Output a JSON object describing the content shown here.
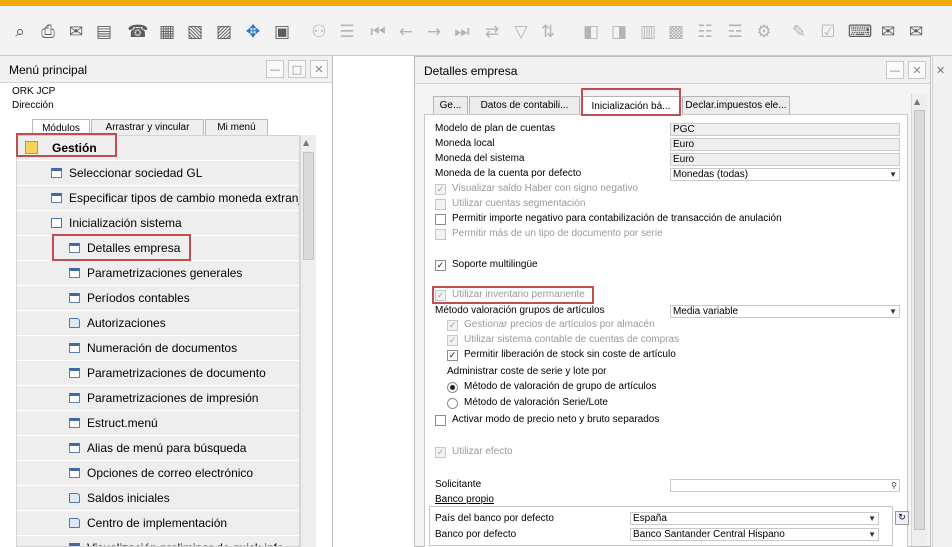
{
  "toolbar": {
    "icons": [
      "print-preview-icon",
      "print-icon",
      "email-icon",
      "sms-icon",
      "fax-icon",
      "export-excel-icon",
      "export-word-icon",
      "export-pdf-icon",
      "move-icon",
      "lock-icon",
      "binoculars-icon",
      "document-icon",
      "first-record-icon",
      "previous-record-icon",
      "next-record-icon",
      "last-record-icon",
      "refresh-icon",
      "filter-icon",
      "sort-icon",
      "base-document-icon",
      "target-document-icon",
      "layout-icon",
      "gross-profit-icon",
      "journal-icon",
      "transaction-journal-icon",
      "settings-icon",
      "pen-icon",
      "check-icon",
      "calc-icon",
      "messages-icon",
      "alerts-icon"
    ]
  },
  "menu": {
    "title": "Menú principal",
    "company": "ORK JCP",
    "role": "Dirección",
    "tabs": [
      "Módulos",
      "Arrastrar y vincular",
      "Mi menú"
    ],
    "module": "Gestión",
    "items": [
      {
        "label": "Seleccionar sociedad GL",
        "icon": "form",
        "level": 1
      },
      {
        "label": "Especificar tipos de cambio moneda extranjera",
        "icon": "form",
        "level": 1
      },
      {
        "label": "Inicialización sistema",
        "icon": "folder-open",
        "level": 1
      },
      {
        "label": "Detalles empresa",
        "icon": "form",
        "level": 2
      },
      {
        "label": "Parametrizaciones generales",
        "icon": "form",
        "level": 2
      },
      {
        "label": "Períodos contables",
        "icon": "form",
        "level": 2
      },
      {
        "label": "Autorizaciones",
        "icon": "folder",
        "level": 2
      },
      {
        "label": "Numeración de documentos",
        "icon": "form",
        "level": 2
      },
      {
        "label": "Parametrizaciones de documento",
        "icon": "form",
        "level": 2
      },
      {
        "label": "Parametrizaciones de impresión",
        "icon": "form",
        "level": 2
      },
      {
        "label": "Estruct.menú",
        "icon": "form",
        "level": 2
      },
      {
        "label": "Alias de menú para búsqueda",
        "icon": "form",
        "level": 2
      },
      {
        "label": "Opciones de correo electrónico",
        "icon": "form",
        "level": 2
      },
      {
        "label": "Saldos iniciales",
        "icon": "folder",
        "level": 2
      },
      {
        "label": "Centro de implementación",
        "icon": "folder",
        "level": 2
      },
      {
        "label": "Visualización preliminar de quick info",
        "icon": "form",
        "level": 2
      }
    ]
  },
  "details": {
    "title": "Detalles empresa",
    "tabs": [
      "Ge...",
      "Datos de contabili...",
      "Inicialización bá...",
      "Declar.impuestos ele..."
    ],
    "fields": [
      {
        "label": "Modelo de plan de cuentas",
        "value": "PGC"
      },
      {
        "label": "Moneda local",
        "value": "Euro"
      },
      {
        "label": "Moneda del sistema",
        "value": "Euro"
      },
      {
        "label": "Moneda de la cuenta por defecto",
        "value": "Monedas (todas)"
      }
    ],
    "checks1": [
      {
        "label": "Visualizar saldo Haber con signo negativo",
        "checked": true,
        "disabled": true
      },
      {
        "label": "Utilizar cuentas segmentación",
        "checked": false,
        "disabled": true
      },
      {
        "label": "Permitir importe negativo para contabilización de transacción de anulación",
        "checked": false,
        "disabled": false
      },
      {
        "label": "Permitir más de un tipo de documento por serie",
        "checked": false,
        "disabled": true
      }
    ],
    "multilang": {
      "label": "Soporte multilingüe",
      "checked": true
    },
    "perpetual": {
      "label": "Utilizar inventario permanente",
      "checked": true
    },
    "valuation": {
      "label": "Método valoración grupos de artículos",
      "value": "Media variable"
    },
    "checks2": [
      {
        "label": "Gestionar precios de artículos por almacén",
        "checked": true,
        "disabled": true
      },
      {
        "label": "Utilizar sistema contable de cuentas de compras",
        "checked": true,
        "disabled": true
      },
      {
        "label": "Permitir liberación de stock sin coste de artículo",
        "checked": true,
        "disabled": false
      }
    ],
    "serial_label": "Administrar coste de serie y lote por",
    "radios": [
      {
        "label": "Método de valoración de grupo de artículos",
        "checked": true
      },
      {
        "label": "Método de valoración Serie/Lote",
        "checked": false
      }
    ],
    "netgross": {
      "label": "Activar modo de precio neto y bruto separados",
      "checked": false
    },
    "effect": {
      "label": "Utilizar efecto",
      "checked": true
    },
    "solicitante": {
      "label": "Solicitante",
      "value": ""
    },
    "bank_title": "Banco propio",
    "bank_country": {
      "label": "País del banco por defecto",
      "value": "España"
    },
    "bank_default": {
      "label": "Banco por defecto",
      "value": "Banco Santander Central Hispano"
    }
  },
  "colors": {
    "accent": "#f0ab00",
    "highlight": "#c0504d"
  }
}
